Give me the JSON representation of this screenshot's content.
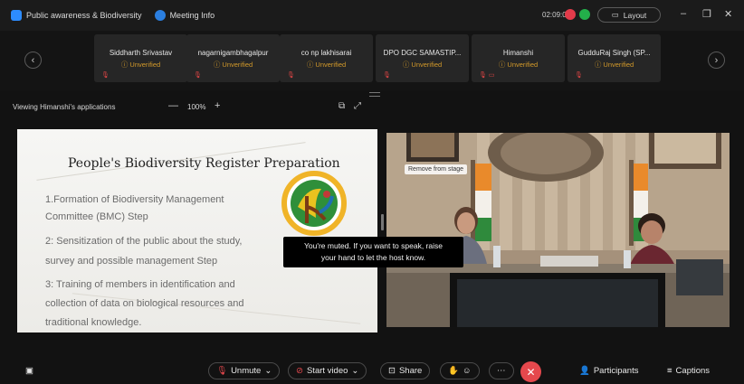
{
  "titlebar": {
    "meeting_name": "Public awareness & Biodiversity",
    "meeting_info": "Meeting Info",
    "timer": "02:09:04",
    "layout_label": "Layout",
    "minimize": "–",
    "restore": "❐",
    "close": "✕"
  },
  "participants": [
    {
      "name": "Siddharth Srivastav",
      "status": "Unverified"
    },
    {
      "name": "nagarnigambhagalpur",
      "status": "Unverified"
    },
    {
      "name": "co np lakhisarai",
      "status": "Unverified"
    },
    {
      "name": "DPO DGC SAMASTIP...",
      "status": "Unverified"
    },
    {
      "name": "Himanshi",
      "status": "Unverified"
    },
    {
      "name": "GudduRaj Singh (SP...",
      "status": "Unverified"
    }
  ],
  "viewbar": {
    "label": "Viewing Himanshi's applications",
    "zoom_minus": "—",
    "zoom": "100%",
    "zoom_plus": "+"
  },
  "slide": {
    "title": "People's Biodiversity Register  Preparation",
    "lines": [
      "1.Formation of Biodiversity Management",
      "Committee (BMC) Step",
      "2: Sensitization of the public about the study,",
      "survey and possible management Step",
      "3: Training of members in identification and",
      "collection of data on biological resources and",
      "traditional knowledge."
    ]
  },
  "video": {
    "remove_tag": "Remove from stage"
  },
  "toast": {
    "line1": "You're muted. If you want to speak, raise",
    "line2": "your hand to let the host know."
  },
  "toolbar": {
    "unmute": "Unmute",
    "start_video": "Start video",
    "share": "Share",
    "participants": "Participants",
    "captions": "Captions"
  },
  "colors": {
    "accent": "#2d8cff",
    "danger": "#e5484d",
    "unverified": "#d59b2a"
  }
}
